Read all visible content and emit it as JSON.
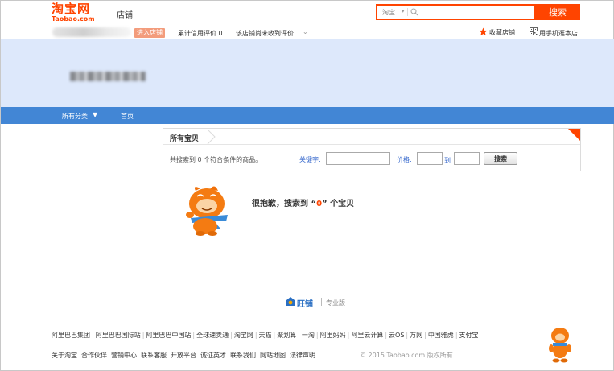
{
  "header": {
    "logo_main": "淘宝网",
    "logo_sub": "Taobao.com",
    "section": "店铺",
    "search": {
      "scope": "淘宝",
      "placeholder": "",
      "button": "搜索"
    }
  },
  "shop_info": {
    "enter_shop": "进入店铺",
    "credit": "累计信用评价 0",
    "no_reviews": "该店铺尚未收到评价",
    "favorite": "收藏店铺",
    "mobile": "用手机逛本店"
  },
  "nav": {
    "all_categories": "所有分类",
    "home": "首页"
  },
  "search_panel": {
    "tab": "所有宝贝",
    "result_summary": "共搜索到 0 个符合条件的商品。",
    "keyword_label": "关键字:",
    "price_label": "价格:",
    "to_label": "到",
    "button": "搜索"
  },
  "empty": {
    "prefix": "很抱歉，搜索到 “",
    "query": "0",
    "suffix": "” 个宝贝"
  },
  "wangpu": {
    "name": "旺铺",
    "edition": "专业版"
  },
  "footer": {
    "row1": [
      "阿里巴巴集团",
      "阿里巴巴国际站",
      "阿里巴巴中国站",
      "全球速卖通",
      "淘宝网",
      "天猫",
      "聚划算",
      "一淘",
      "阿里妈妈",
      "阿里云计算",
      "云OS",
      "万网",
      "中国雅虎",
      "支付宝"
    ],
    "row2": [
      "关于淘宝",
      "合作伙伴",
      "营销中心",
      "联系客服",
      "开放平台",
      "诚征英才",
      "联系我们",
      "网站地图",
      "法律声明"
    ],
    "copyright": "© 2015 Taobao.com 版权所有"
  },
  "colors": {
    "brand": "#ff4400",
    "nav": "#4286d5",
    "banner": "#dde8fb",
    "link": "#3366cc"
  }
}
